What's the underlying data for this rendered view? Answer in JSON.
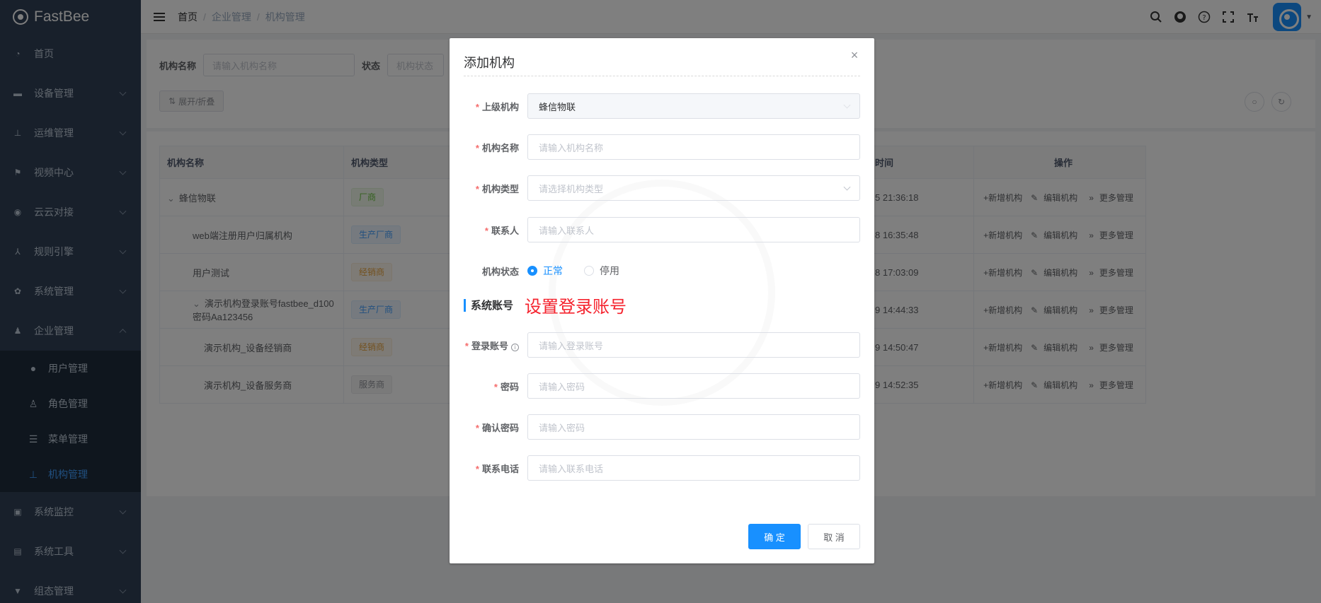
{
  "app": {
    "name": "FastBee"
  },
  "sidebar": {
    "items": [
      {
        "label": "首页",
        "icon": "dashboard-icon"
      },
      {
        "label": "设备管理",
        "icon": "device-icon"
      },
      {
        "label": "运维管理",
        "icon": "tree-icon"
      },
      {
        "label": "视频中心",
        "icon": "video-icon"
      },
      {
        "label": "云云对接",
        "icon": "eye-icon"
      },
      {
        "label": "规则引擎",
        "icon": "rule-icon"
      },
      {
        "label": "系统管理",
        "icon": "gear-icon"
      },
      {
        "label": "企业管理",
        "icon": "user-group-icon"
      }
    ],
    "sub_items": [
      {
        "label": "用户管理",
        "icon": "user-icon"
      },
      {
        "label": "角色管理",
        "icon": "role-icon"
      },
      {
        "label": "菜单管理",
        "icon": "menu-tree-icon"
      },
      {
        "label": "机构管理",
        "icon": "org-icon",
        "active": true
      }
    ],
    "bottom_items": [
      {
        "label": "系统监控",
        "icon": "monitor-icon"
      },
      {
        "label": "系统工具",
        "icon": "toolbox-icon"
      },
      {
        "label": "组态管理",
        "icon": "layout-icon"
      }
    ]
  },
  "topbar": {
    "breadcrumb": [
      "首页",
      "企业管理",
      "机构管理"
    ]
  },
  "search": {
    "name_label": "机构名称",
    "name_placeholder": "请输入机构名称",
    "status_label": "状态",
    "status_placeholder": "机构状态",
    "expand_button": "展开/折叠"
  },
  "table": {
    "headers": [
      "机构名称",
      "机构类型",
      "创建时间",
      "操作"
    ],
    "create_time_header_visible": "时间",
    "rows": [
      {
        "name": "蜂信物联",
        "type": "厂商",
        "type_color": "green",
        "time": "5 21:36:18",
        "indent": 0,
        "expand": true
      },
      {
        "name": "web端注册用户归属机构",
        "type": "生产厂商",
        "type_color": "blue",
        "time": "8 16:35:48",
        "indent": 1
      },
      {
        "name": "用户测试",
        "type": "经销商",
        "type_color": "orange",
        "time": "8 17:03:09",
        "indent": 1
      },
      {
        "name": "演示机构登录账号fastbee_d100 密码Aa123456",
        "type": "生产厂商",
        "type_color": "blue",
        "time": "9 14:44:33",
        "indent": 1,
        "expand": true
      },
      {
        "name": "演示机构_设备经销商",
        "type": "经销商",
        "type_color": "orange",
        "time": "9 14:50:47",
        "indent": 2
      },
      {
        "name": "演示机构_设备服务商",
        "type": "服务商",
        "type_color": "gray",
        "time": "9 14:52:35",
        "indent": 2
      }
    ],
    "ops": [
      "+新增机构",
      "编辑机构",
      "更多管理"
    ]
  },
  "dialog": {
    "title": "添加机构",
    "fields": {
      "parent_label": "上级机构",
      "parent_value": "蜂信物联",
      "name_label": "机构名称",
      "name_placeholder": "请输入机构名称",
      "type_label": "机构类型",
      "type_placeholder": "请选择机构类型",
      "contact_label": "联系人",
      "contact_placeholder": "请输入联系人",
      "status_label": "机构状态",
      "status_normal": "正常",
      "status_disabled": "停用",
      "account_label": "登录账号",
      "account_placeholder": "请输入登录账号",
      "password_label": "密码",
      "password_placeholder": "请输入密码",
      "confirm_label": "确认密码",
      "confirm_placeholder": "请输入密码",
      "phone_label": "联系电话",
      "phone_placeholder": "请输入联系电话"
    },
    "section_title": "系统账号",
    "section_note": "设置登录账号",
    "confirm_button": "确 定",
    "cancel_button": "取 消"
  }
}
